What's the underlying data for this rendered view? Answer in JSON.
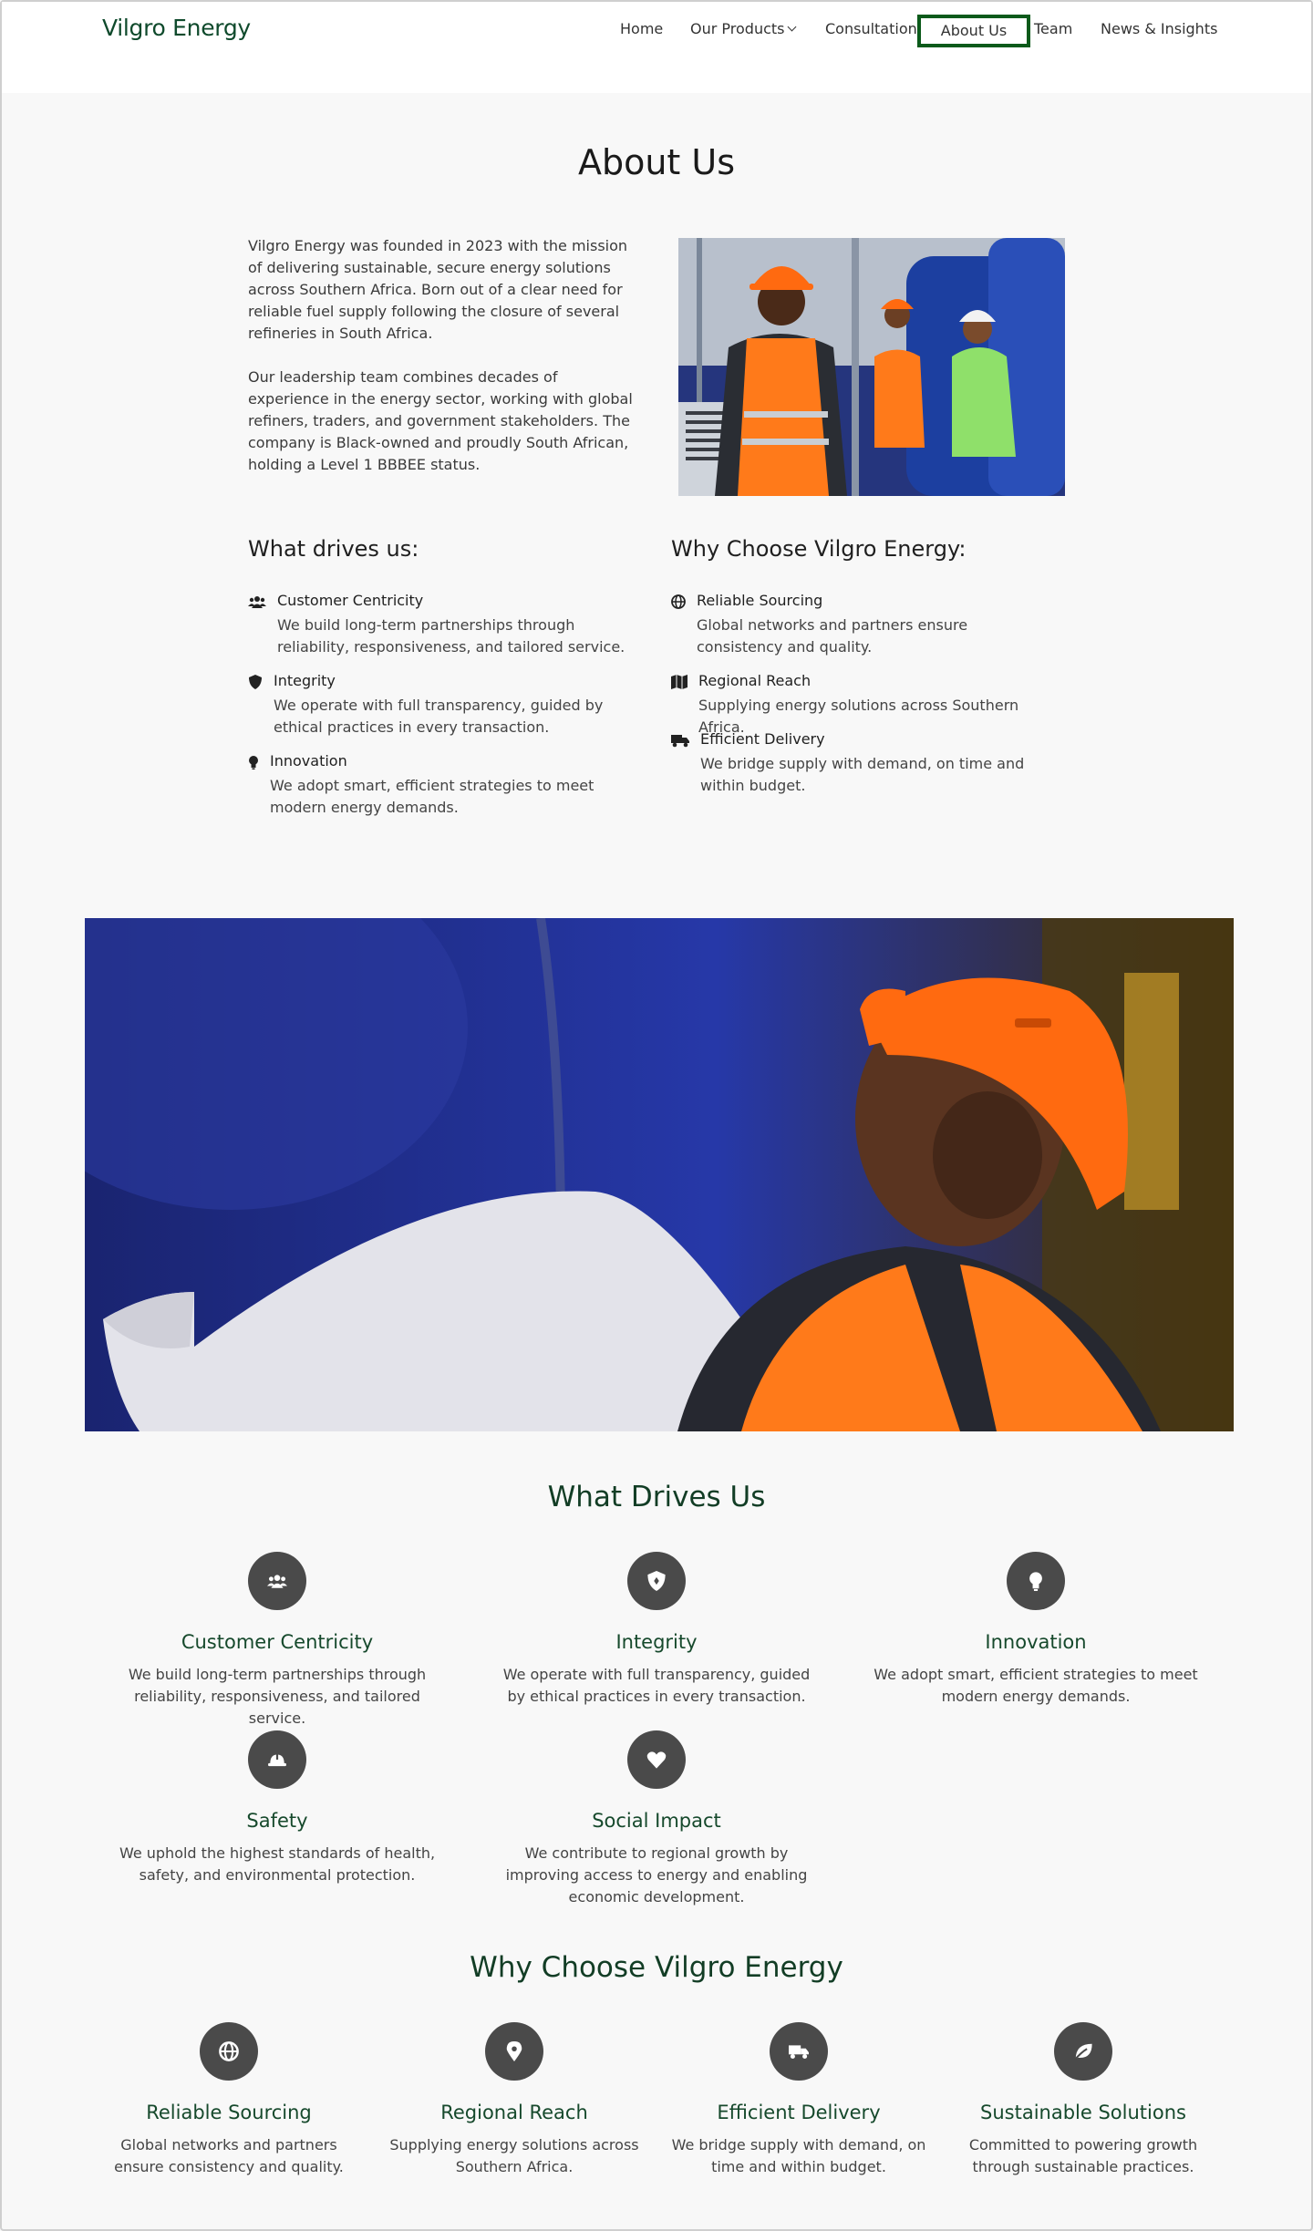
{
  "header": {
    "brand": "Vilgro Energy",
    "nav": {
      "home": "Home",
      "products": "Our Products",
      "consultation": "Consultation",
      "about": "About Us",
      "team": "Team",
      "news": "News & Insights"
    }
  },
  "about": {
    "title": "About Us",
    "paragraph1": "Vilgro Energy was founded in 2023 with the mission of delivering sustainable, secure energy solutions across Southern Africa. Born out of a clear need for reliable fuel supply following the closure of several refineries in South Africa.",
    "paragraph2": "Our leadership team combines decades of experience in the energy sector, working with global refiners, traders, and government stakeholders. The company is Black-owned and proudly South African, holding a Level 1 BBBEE status."
  },
  "drives": {
    "heading": "What drives us:",
    "items": [
      {
        "icon": "users-icon",
        "title": "Customer Centricity",
        "desc": "We build long-term partnerships through reliability, responsiveness, and tailored service."
      },
      {
        "icon": "shield-icon",
        "title": "Integrity",
        "desc": "We operate with full transparency, guided by ethical practices in every transaction."
      },
      {
        "icon": "lightbulb-icon",
        "title": "Innovation",
        "desc": "We adopt smart, efficient strategies to meet modern energy demands."
      }
    ]
  },
  "choose": {
    "heading": "Why Choose Vilgro Energy:",
    "items": [
      {
        "icon": "globe-icon",
        "title": "Reliable Sourcing",
        "desc": "Global networks and partners ensure consistency and quality."
      },
      {
        "icon": "map-icon",
        "title": "Regional Reach",
        "desc": "Supplying energy solutions across Southern Africa."
      },
      {
        "icon": "truck-icon",
        "title": "Efficient Delivery",
        "desc": "We bridge supply with demand, on time and within budget."
      }
    ]
  },
  "values": {
    "title": "What Drives Us",
    "cards": [
      {
        "icon": "users-icon",
        "title": "Customer Centricity",
        "desc": "We build long-term partnerships through reliability, responsiveness, and tailored service."
      },
      {
        "icon": "shield-icon",
        "title": "Integrity",
        "desc": "We operate with full transparency, guided by ethical practices in every transaction."
      },
      {
        "icon": "lightbulb-icon",
        "title": "Innovation",
        "desc": "We adopt smart, efficient strategies to meet modern energy demands."
      },
      {
        "icon": "hard-hat-icon",
        "title": "Safety",
        "desc": "We uphold the highest standards of health, safety, and environmental protection."
      },
      {
        "icon": "heart-icon",
        "title": "Social Impact",
        "desc": "We contribute to regional growth by improving access to energy and enabling economic development."
      }
    ]
  },
  "why": {
    "title": "Why Choose Vilgro Energy",
    "cards": [
      {
        "icon": "globe-icon",
        "title": "Reliable Sourcing",
        "desc": "Global networks and partners ensure consistency and quality."
      },
      {
        "icon": "map-pin-icon",
        "title": "Regional Reach",
        "desc": "Supplying energy solutions across Southern Africa."
      },
      {
        "icon": "truck-icon",
        "title": "Efficient Delivery",
        "desc": "We bridge supply with demand, on time and within budget."
      },
      {
        "icon": "leaf-icon",
        "title": "Sustainable Solutions",
        "desc": "Committed to powering growth through sustainable practices."
      }
    ]
  },
  "colors": {
    "brand_green": "#0f4a2c",
    "active_border": "#0b5a1a",
    "icon_circle": "#4a4a4a",
    "safety_orange": "#ff7a1a"
  }
}
